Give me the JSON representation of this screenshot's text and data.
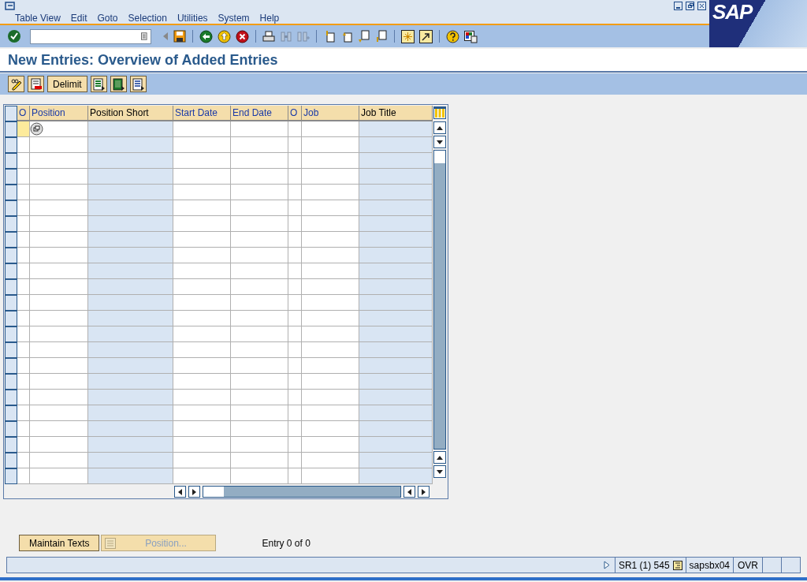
{
  "menu": [
    "Table View",
    "Edit",
    "Goto",
    "Selection",
    "Utilities",
    "System",
    "Help"
  ],
  "logo": "SAP",
  "title": "New Entries: Overview of Added Entries",
  "app_toolbar": [
    {
      "kind": "icon"
    },
    {
      "kind": "icon"
    },
    {
      "kind": "text",
      "label": "Delimit"
    },
    {
      "kind": "icon"
    },
    {
      "kind": "icon"
    },
    {
      "kind": "icon"
    }
  ],
  "table": {
    "columns": [
      {
        "label": "O",
        "editable": true
      },
      {
        "label": "Position",
        "editable": true
      },
      {
        "label": "Position Short",
        "editable": false
      },
      {
        "label": "Start Date",
        "editable": true
      },
      {
        "label": "End Date",
        "editable": true
      },
      {
        "label": "O",
        "editable": true
      },
      {
        "label": "Job",
        "editable": true
      },
      {
        "label": "Job Title",
        "editable": false
      }
    ]
  },
  "footer_buttons": [
    {
      "label": "Maintain Texts",
      "disabled": false
    },
    {
      "label": "Position...",
      "disabled": true
    }
  ],
  "entry_info": "Entry 0 of 0",
  "status_bar": {
    "system": "SR1 (1) 545",
    "server": "sapsbx04",
    "mode": "OVR"
  }
}
